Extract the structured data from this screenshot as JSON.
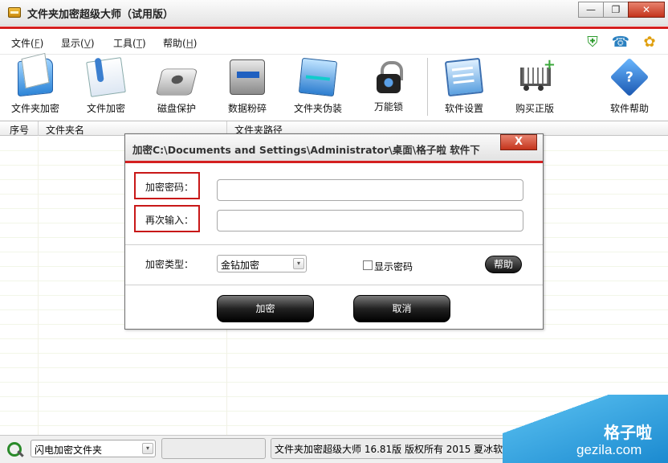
{
  "window": {
    "title": "文件夹加密超级大师（试用版）",
    "min_glyph": "—",
    "restore_glyph": "❐",
    "close_glyph": "✕"
  },
  "menu": [
    {
      "label": "文件(",
      "acc": "F",
      "tail": ")"
    },
    {
      "label": "显示(",
      "acc": "V",
      "tail": ")"
    },
    {
      "label": "工具(",
      "acc": "T",
      "tail": ")"
    },
    {
      "label": "帮助(",
      "acc": "H",
      "tail": ")"
    }
  ],
  "toolbar": [
    {
      "label": "文件夹加密",
      "icon": "folder-encrypt-icon"
    },
    {
      "label": "文件加密",
      "icon": "file-encrypt-icon"
    },
    {
      "label": "磁盘保护",
      "icon": "disk-protect-icon"
    },
    {
      "label": "数据粉碎",
      "icon": "shredder-icon"
    },
    {
      "label": "文件夹伪装",
      "icon": "folder-disguise-icon"
    },
    {
      "label": "万能锁",
      "icon": "lock-icon"
    },
    {
      "label": "软件设置",
      "icon": "settings-icon"
    },
    {
      "label": "购买正版",
      "icon": "cart-icon"
    },
    {
      "label": "软件帮助",
      "icon": "help-icon"
    }
  ],
  "list": {
    "columns": [
      "序号",
      "文件夹名",
      "文件夹路径"
    ]
  },
  "dialog": {
    "title": "加密C:\\Documents and Settings\\Administrator\\桌面\\格子啦 软件下",
    "close_glyph": "X",
    "password_label": "加密密码：",
    "confirm_label": "再次输入：",
    "password_value": "",
    "confirm_value": "",
    "type_label": "加密类型：",
    "type_value": "金钻加密",
    "show_password_label": "显示密码",
    "show_password_checked": false,
    "help_label": "帮助",
    "encrypt_label": "加密",
    "cancel_label": "取消"
  },
  "status": {
    "combo_value": "闪电加密文件夹",
    "copyright": "文件夹加密超级大师 16.81版 版权所有 2015 夏冰软件(",
    "arrow_glyph": "▾"
  },
  "watermark": {
    "cn": "格子啦",
    "en": "gezila.com"
  },
  "colors": {
    "accent_red": "#d42020",
    "close_red": "#c4341c"
  }
}
